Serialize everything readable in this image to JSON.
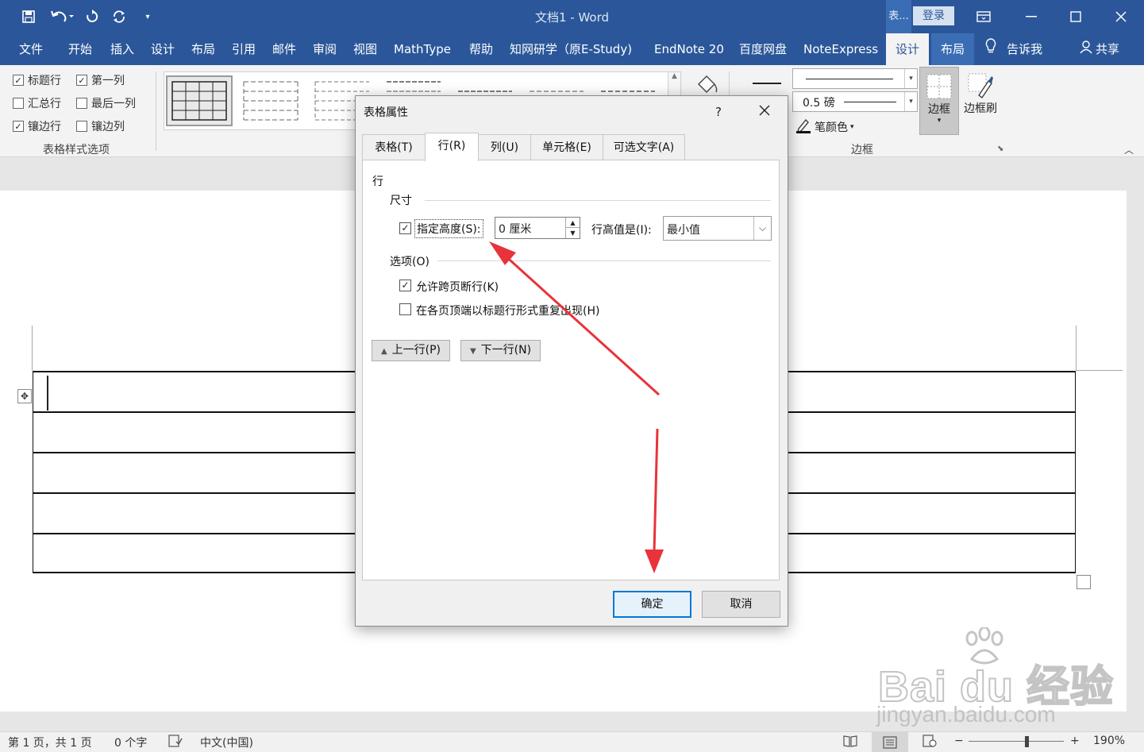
{
  "window": {
    "doc_title": "文档1  -  Word",
    "context_tab_title": "表...",
    "login_label": "登录"
  },
  "menubar": {
    "tabs": [
      "文件",
      "开始",
      "插入",
      "设计",
      "布局",
      "引用",
      "邮件",
      "审阅",
      "视图",
      "MathType",
      "帮助",
      "知网研学（原E-Study)",
      "EndNote 20",
      "百度网盘",
      "NoteExpress"
    ],
    "context_tabs": [
      "设计",
      "布局"
    ],
    "tell_me": "告诉我",
    "share": "共享"
  },
  "ribbon": {
    "style_options": {
      "header_row": {
        "label": "标题行",
        "checked": true
      },
      "first_column": {
        "label": "第一列",
        "checked": true
      },
      "total_row": {
        "label": "汇总行",
        "checked": false
      },
      "last_column": {
        "label": "最后一列",
        "checked": false
      },
      "banded_rows": {
        "label": "镶边行",
        "checked": true
      },
      "banded_columns": {
        "label": "镶边列",
        "checked": false
      },
      "group_label": "表格样式选项"
    },
    "borders": {
      "pen_weight": "0.5 磅",
      "pen_color": "笔颜色",
      "borders_button": "边框",
      "border_painter": "边框刷",
      "group_label": "边框"
    }
  },
  "dialog": {
    "title": "表格属性",
    "help": "?",
    "tabs": [
      "表格(T)",
      "行(R)",
      "列(U)",
      "单元格(E)",
      "可选文字(A)"
    ],
    "active_tab": "行(R)",
    "section_row": "行",
    "section_size": "尺寸",
    "specify_height": {
      "label": "指定高度(S):",
      "checked": true
    },
    "height_value": "0 厘米",
    "row_height_is_label": "行高值是(I):",
    "row_height_is_value": "最小值",
    "section_options": "选项(O)",
    "allow_break": {
      "label": "允许跨页断行(K)",
      "checked": true
    },
    "repeat_header": {
      "label": "在各页顶端以标题行形式重复出现(H)",
      "checked": false
    },
    "prev_row": "上一行(P)",
    "next_row": "下一行(N)",
    "ok": "确定",
    "cancel": "取消"
  },
  "watermark": {
    "brand": "Bai du 经验",
    "url": "jingyan.baidu.com"
  },
  "statusbar": {
    "page": "第 1 页，共 1 页",
    "words": "0 个字",
    "language": "中文(中国)",
    "zoom": "190%"
  },
  "colors": {
    "word_blue": "#2b579a",
    "annotation_red": "#e8333a",
    "primary_button_border": "#0078d7"
  }
}
